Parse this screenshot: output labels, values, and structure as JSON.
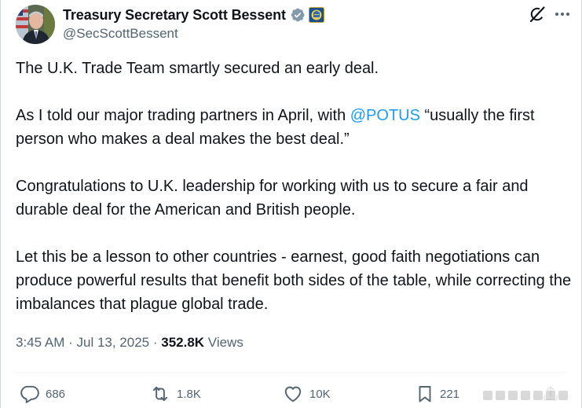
{
  "author": {
    "display_name": "Treasury Secretary Scott Bessent",
    "handle": "@SecScottBessent",
    "verified_icon": "verified-badge-icon",
    "affiliation_icon": "treasury-seal-icon"
  },
  "header_icons": {
    "grok": "grok-icon",
    "more": "more-icon"
  },
  "tweet": {
    "p1": "The U.K. Trade Team smartly secured an early deal.",
    "p2_before": "As I told our major trading partners in April, with ",
    "p2_mention": "@POTUS",
    "p2_after": " “usually the first person who makes a deal makes the best deal.”",
    "p3": "Congratulations to U.K. leadership for working with us to secure a fair and durable deal for the American and British people.",
    "p4": "Let this be a lesson to other countries - earnest, good faith negotiations can produce powerful results that benefit both sides of the table, while correcting the imbalances that plague global trade."
  },
  "meta": {
    "time": "3:45 AM",
    "separator": " · ",
    "date": "Jul 13, 2025",
    "views_count": "352.8K",
    "views_label": " Views"
  },
  "actions": {
    "replies": "686",
    "reposts": "1.8K",
    "likes": "10K",
    "bookmarks": "221"
  },
  "colors": {
    "text": "#0f1419",
    "secondary": "#536471",
    "link": "#1d9bf0",
    "verified": "#829aab"
  }
}
